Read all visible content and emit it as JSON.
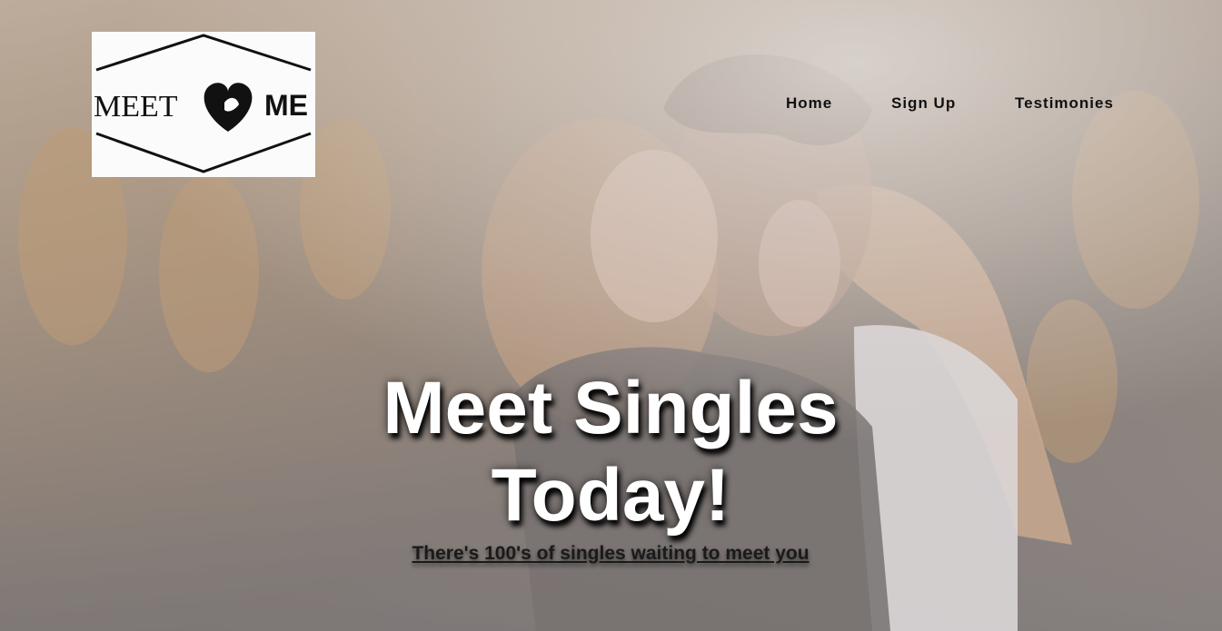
{
  "logo": {
    "text_left": "MEET",
    "text_right": "ME",
    "icon": "heart-icon",
    "background": "#fbfbfb"
  },
  "nav": {
    "items": [
      {
        "label": "Home"
      },
      {
        "label": "Sign Up"
      },
      {
        "label": "Testimonies"
      }
    ]
  },
  "hero": {
    "headline_line1": "Meet Singles",
    "headline_line2": "Today!",
    "subtitle": "There's 100's of singles waiting to meet you",
    "background_image": "couple-kissing-photo"
  },
  "colors": {
    "nav_text": "#111111",
    "headline": "#ffffff",
    "subtitle": "#1a1a1a"
  }
}
